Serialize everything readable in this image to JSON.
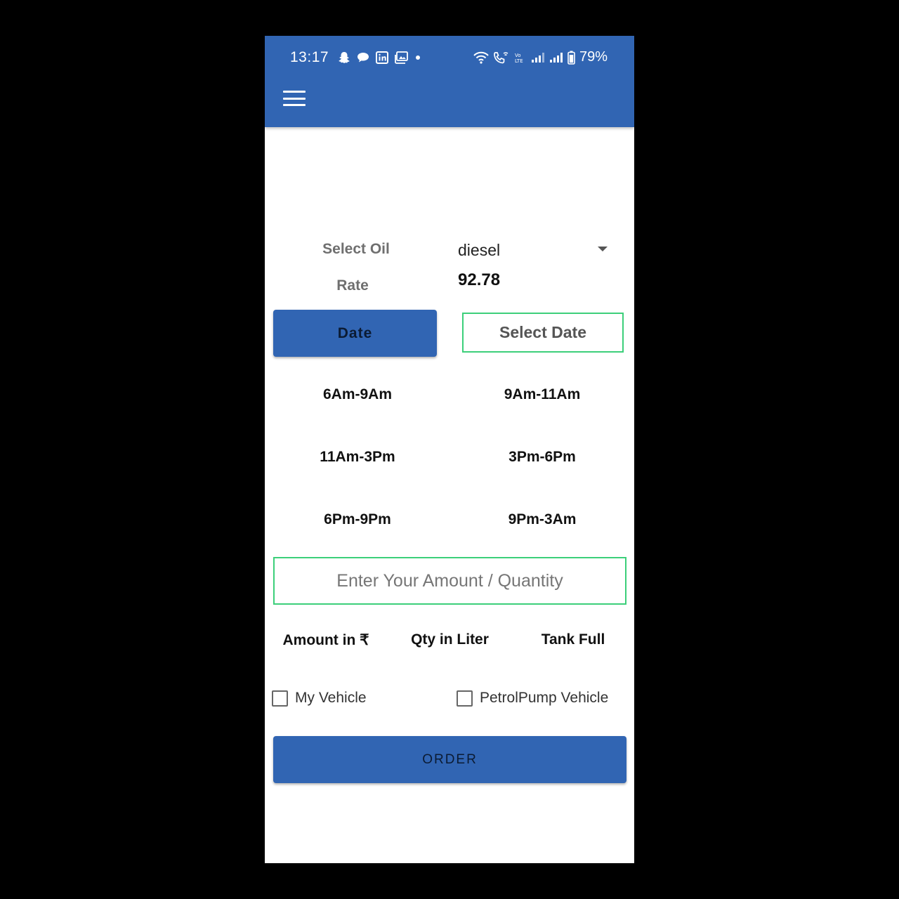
{
  "status_bar": {
    "time": "13:17",
    "battery": "79%",
    "notification_icons": [
      "snapchat-icon",
      "chat-icon",
      "linkedin-icon",
      "gallery-icon",
      "dot-icon"
    ],
    "system_icons": [
      "wifi-icon",
      "wifi-call-icon",
      "volte-icon",
      "signal-icon",
      "signal-icon",
      "battery-icon"
    ]
  },
  "app_bar": {
    "menu_icon": "hamburger-menu-icon",
    "color": "#3165b3"
  },
  "form": {
    "oil_label": "Select Oil",
    "oil_value": "diesel",
    "rate_label": "Rate",
    "rate_value": "92.78",
    "date_button": "Date",
    "select_date": "Select Date",
    "time_slots": [
      "6Am-9Am",
      "9Am-11Am",
      "11Am-3Pm",
      "3Pm-6Pm",
      "6Pm-9Pm",
      "9Pm-3Am"
    ],
    "amount_placeholder": "Enter Your Amount / Quantity",
    "options": [
      "Amount in ₹",
      "Qty in Liter",
      "Tank Full"
    ],
    "vehicle_options": [
      "My Vehicle",
      "PetrolPump Vehicle"
    ],
    "order_button": "ORDER"
  },
  "colors": {
    "primary": "#3165b3",
    "accent_border": "#3ccf7a"
  }
}
